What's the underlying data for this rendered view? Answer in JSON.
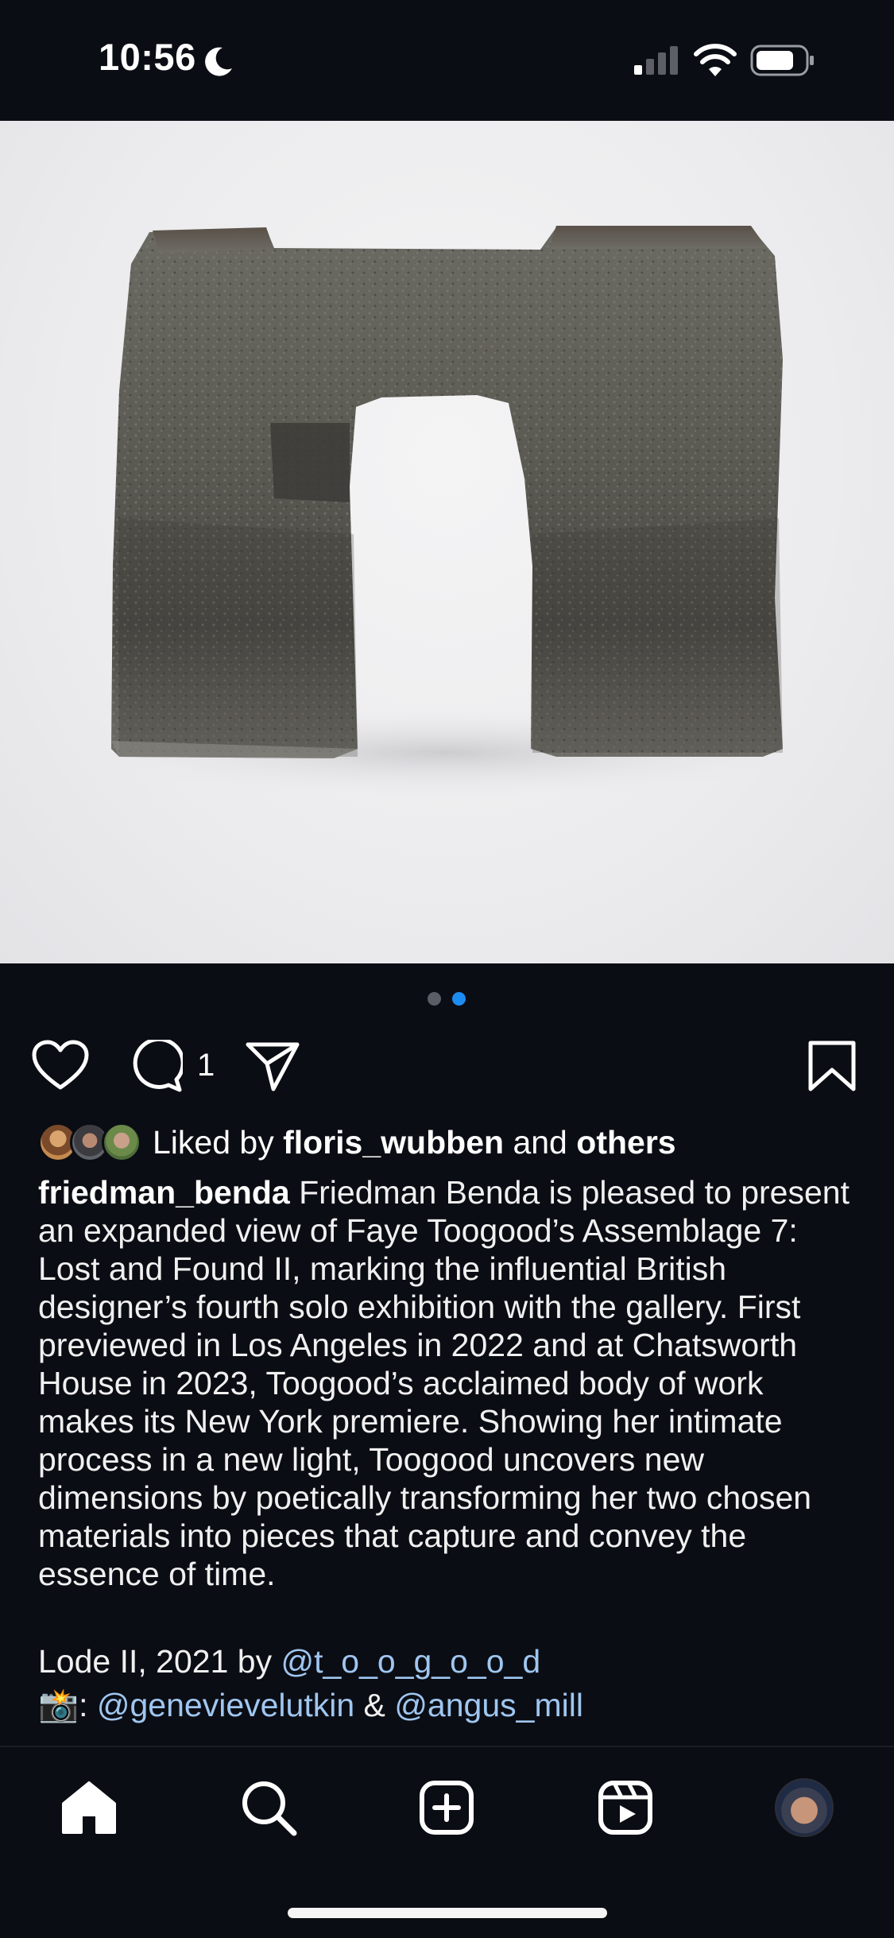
{
  "status_bar": {
    "time": "10:56",
    "icons": [
      "moon-icon",
      "signal-icon",
      "wifi-icon",
      "battery-icon"
    ]
  },
  "media": {
    "carousel_total": 2,
    "carousel_active": 2
  },
  "actions": {
    "comment_count": "1",
    "icons": [
      "heart-icon",
      "comment-icon",
      "share-icon",
      "bookmark-icon"
    ]
  },
  "likes": {
    "prefix": "Liked by",
    "user": "floris_wubben",
    "connector": "and",
    "others": "others"
  },
  "caption": {
    "username": "friedman_benda",
    "text": "Friedman Benda is pleased to present an expanded view of Faye Toogood’s Assemblage 7: Lost and Found II, marking the influential British designer’s fourth solo exhibition with the gallery. First previewed in Los Angeles in 2022 and at Chatsworth House in 2023, Toogood’s acclaimed body of work makes its New York premiere. Showing her intimate process in a new light, Toogood uncovers new dimensions by poetically transforming her two chosen materials into pieces that capture and convey the essence of time."
  },
  "credits": {
    "line1_prefix": "Lode II, 2021 by",
    "line1_mention": "@t_o_o_g_o_o_d",
    "camera_emoji": "📸",
    "colon": ":",
    "mention_1": "@genevievelutkin",
    "ampersand": "&",
    "mention_2": "@angus_mill"
  },
  "tab_bar": {
    "tabs": [
      "home-icon",
      "search-icon",
      "create-icon",
      "reels-icon",
      "profile-avatar"
    ],
    "active": "home"
  },
  "colors": {
    "background": "#0b0d14",
    "mention": "#9fc6f0",
    "active_dot": "#1d8cf0"
  }
}
